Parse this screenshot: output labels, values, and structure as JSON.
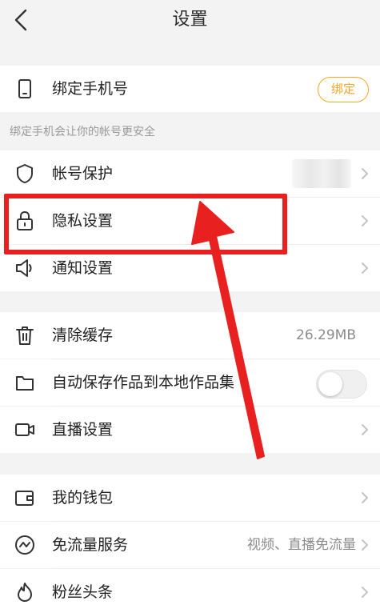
{
  "header": {
    "title": "设置"
  },
  "section1": {
    "bind_phone": {
      "label": "绑定手机号",
      "button": "绑定"
    },
    "note": "绑定手机会让你的帐号更安全"
  },
  "section2": {
    "items": [
      {
        "label": "帐号保护",
        "icon": "shield-icon"
      },
      {
        "label": "隐私设置",
        "icon": "lock-icon"
      },
      {
        "label": "通知设置",
        "icon": "speaker-icon"
      }
    ]
  },
  "section3": {
    "items": [
      {
        "label": "清除缓存",
        "value": "26.29MB",
        "icon": "trash-icon"
      },
      {
        "label": "自动保存作品到本地作品集",
        "icon": "folder-icon",
        "toggle_on": false
      },
      {
        "label": "直播设置",
        "icon": "video-camera-icon"
      }
    ]
  },
  "section4": {
    "items": [
      {
        "label": "我的钱包",
        "icon": "wallet-icon"
      },
      {
        "label": "免流量服务",
        "value": "视频、直播免流量",
        "icon": "data-plan-icon"
      },
      {
        "label": "粉丝头条",
        "icon": "flame-icon"
      }
    ]
  },
  "colors": {
    "accent": "#f5a623",
    "annotation": "#e8201f"
  }
}
